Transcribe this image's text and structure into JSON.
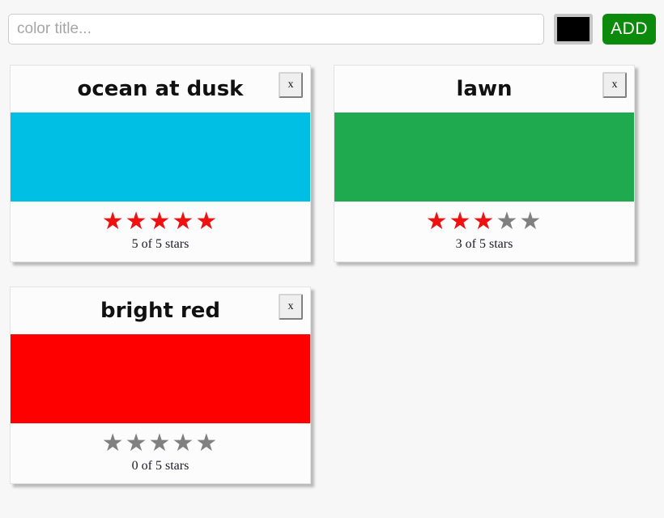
{
  "add_form": {
    "title_placeholder": "color title...",
    "title_value": "",
    "color_value": "#000000",
    "add_label": "ADD"
  },
  "cards": [
    {
      "title": "ocean at dusk",
      "color": "#00bfe4",
      "close_label": "x",
      "rating": 5,
      "max_rating": 5,
      "rating_caption": "5 of 5 stars",
      "stars": [
        "filled",
        "filled",
        "filled",
        "filled",
        "filled"
      ]
    },
    {
      "title": "lawn",
      "color": "#1faa50",
      "close_label": "x",
      "rating": 3,
      "max_rating": 5,
      "rating_caption": "3 of 5 stars",
      "stars": [
        "filled",
        "filled",
        "filled",
        "empty",
        "empty"
      ]
    },
    {
      "title": "bright red",
      "color": "#ff0000",
      "close_label": "x",
      "rating": 0,
      "max_rating": 5,
      "rating_caption": "0 of 5 stars",
      "stars": [
        "empty",
        "empty",
        "empty",
        "empty",
        "empty"
      ]
    }
  ],
  "icons": {
    "star_glyph": "★"
  },
  "colors": {
    "page_background": "#f7f7f7",
    "card_background": "#fcfcfc",
    "star_filled": "#ee1111",
    "star_empty": "#808080",
    "add_button": "#0b8a0b"
  }
}
